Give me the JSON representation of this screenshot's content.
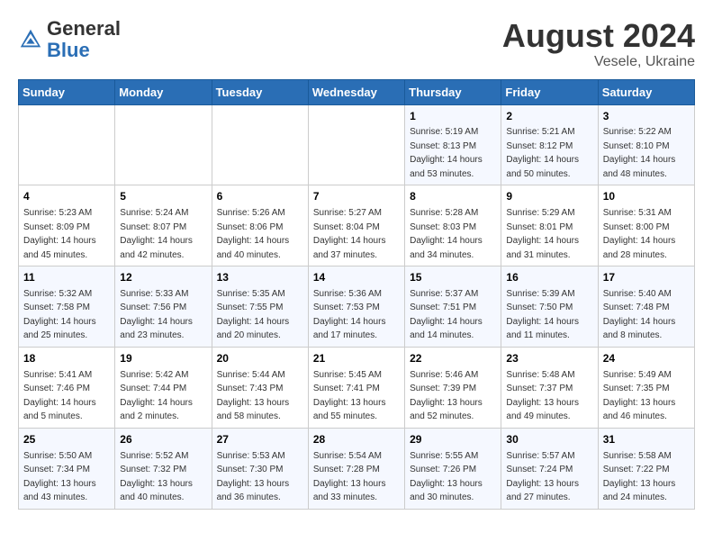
{
  "header": {
    "logo_general": "General",
    "logo_blue": "Blue",
    "month_year": "August 2024",
    "location": "Vesele, Ukraine"
  },
  "days_of_week": [
    "Sunday",
    "Monday",
    "Tuesday",
    "Wednesday",
    "Thursday",
    "Friday",
    "Saturday"
  ],
  "weeks": [
    [
      {
        "day": "",
        "info": ""
      },
      {
        "day": "",
        "info": ""
      },
      {
        "day": "",
        "info": ""
      },
      {
        "day": "",
        "info": ""
      },
      {
        "day": "1",
        "info": "Sunrise: 5:19 AM\nSunset: 8:13 PM\nDaylight: 14 hours\nand 53 minutes."
      },
      {
        "day": "2",
        "info": "Sunrise: 5:21 AM\nSunset: 8:12 PM\nDaylight: 14 hours\nand 50 minutes."
      },
      {
        "day": "3",
        "info": "Sunrise: 5:22 AM\nSunset: 8:10 PM\nDaylight: 14 hours\nand 48 minutes."
      }
    ],
    [
      {
        "day": "4",
        "info": "Sunrise: 5:23 AM\nSunset: 8:09 PM\nDaylight: 14 hours\nand 45 minutes."
      },
      {
        "day": "5",
        "info": "Sunrise: 5:24 AM\nSunset: 8:07 PM\nDaylight: 14 hours\nand 42 minutes."
      },
      {
        "day": "6",
        "info": "Sunrise: 5:26 AM\nSunset: 8:06 PM\nDaylight: 14 hours\nand 40 minutes."
      },
      {
        "day": "7",
        "info": "Sunrise: 5:27 AM\nSunset: 8:04 PM\nDaylight: 14 hours\nand 37 minutes."
      },
      {
        "day": "8",
        "info": "Sunrise: 5:28 AM\nSunset: 8:03 PM\nDaylight: 14 hours\nand 34 minutes."
      },
      {
        "day": "9",
        "info": "Sunrise: 5:29 AM\nSunset: 8:01 PM\nDaylight: 14 hours\nand 31 minutes."
      },
      {
        "day": "10",
        "info": "Sunrise: 5:31 AM\nSunset: 8:00 PM\nDaylight: 14 hours\nand 28 minutes."
      }
    ],
    [
      {
        "day": "11",
        "info": "Sunrise: 5:32 AM\nSunset: 7:58 PM\nDaylight: 14 hours\nand 25 minutes."
      },
      {
        "day": "12",
        "info": "Sunrise: 5:33 AM\nSunset: 7:56 PM\nDaylight: 14 hours\nand 23 minutes."
      },
      {
        "day": "13",
        "info": "Sunrise: 5:35 AM\nSunset: 7:55 PM\nDaylight: 14 hours\nand 20 minutes."
      },
      {
        "day": "14",
        "info": "Sunrise: 5:36 AM\nSunset: 7:53 PM\nDaylight: 14 hours\nand 17 minutes."
      },
      {
        "day": "15",
        "info": "Sunrise: 5:37 AM\nSunset: 7:51 PM\nDaylight: 14 hours\nand 14 minutes."
      },
      {
        "day": "16",
        "info": "Sunrise: 5:39 AM\nSunset: 7:50 PM\nDaylight: 14 hours\nand 11 minutes."
      },
      {
        "day": "17",
        "info": "Sunrise: 5:40 AM\nSunset: 7:48 PM\nDaylight: 14 hours\nand 8 minutes."
      }
    ],
    [
      {
        "day": "18",
        "info": "Sunrise: 5:41 AM\nSunset: 7:46 PM\nDaylight: 14 hours\nand 5 minutes."
      },
      {
        "day": "19",
        "info": "Sunrise: 5:42 AM\nSunset: 7:44 PM\nDaylight: 14 hours\nand 2 minutes."
      },
      {
        "day": "20",
        "info": "Sunrise: 5:44 AM\nSunset: 7:43 PM\nDaylight: 13 hours\nand 58 minutes."
      },
      {
        "day": "21",
        "info": "Sunrise: 5:45 AM\nSunset: 7:41 PM\nDaylight: 13 hours\nand 55 minutes."
      },
      {
        "day": "22",
        "info": "Sunrise: 5:46 AM\nSunset: 7:39 PM\nDaylight: 13 hours\nand 52 minutes."
      },
      {
        "day": "23",
        "info": "Sunrise: 5:48 AM\nSunset: 7:37 PM\nDaylight: 13 hours\nand 49 minutes."
      },
      {
        "day": "24",
        "info": "Sunrise: 5:49 AM\nSunset: 7:35 PM\nDaylight: 13 hours\nand 46 minutes."
      }
    ],
    [
      {
        "day": "25",
        "info": "Sunrise: 5:50 AM\nSunset: 7:34 PM\nDaylight: 13 hours\nand 43 minutes."
      },
      {
        "day": "26",
        "info": "Sunrise: 5:52 AM\nSunset: 7:32 PM\nDaylight: 13 hours\nand 40 minutes."
      },
      {
        "day": "27",
        "info": "Sunrise: 5:53 AM\nSunset: 7:30 PM\nDaylight: 13 hours\nand 36 minutes."
      },
      {
        "day": "28",
        "info": "Sunrise: 5:54 AM\nSunset: 7:28 PM\nDaylight: 13 hours\nand 33 minutes."
      },
      {
        "day": "29",
        "info": "Sunrise: 5:55 AM\nSunset: 7:26 PM\nDaylight: 13 hours\nand 30 minutes."
      },
      {
        "day": "30",
        "info": "Sunrise: 5:57 AM\nSunset: 7:24 PM\nDaylight: 13 hours\nand 27 minutes."
      },
      {
        "day": "31",
        "info": "Sunrise: 5:58 AM\nSunset: 7:22 PM\nDaylight: 13 hours\nand 24 minutes."
      }
    ]
  ]
}
